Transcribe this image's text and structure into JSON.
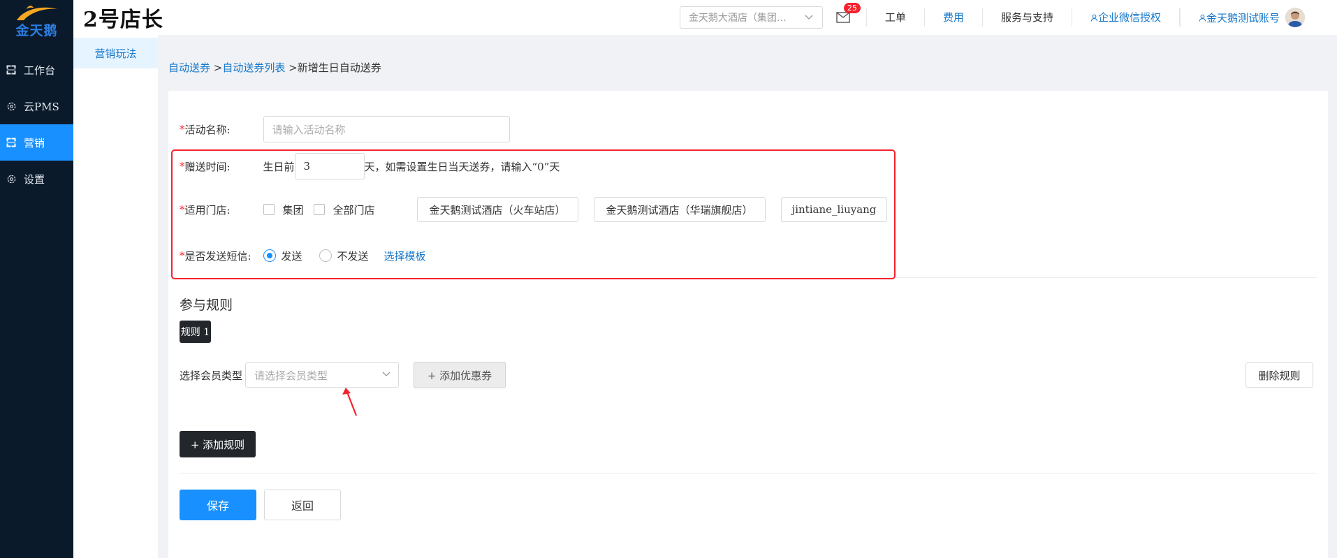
{
  "brand": {
    "logo_text": "金天鹅",
    "title": "2号店长"
  },
  "sidebar": {
    "items": [
      {
        "label": "工作台",
        "icon": "workspace-icon"
      },
      {
        "label": "云PMS",
        "icon": "gear-icon"
      },
      {
        "label": "营销",
        "icon": "marketing-icon",
        "active": true
      },
      {
        "label": "设置",
        "icon": "gear-icon"
      }
    ]
  },
  "submenu": {
    "items": [
      {
        "label": "营销玩法",
        "active": true
      }
    ]
  },
  "header": {
    "hotel_select": "金天鹅大酒店（集团…",
    "mail_badge": "25",
    "nav": [
      "工单",
      "费用",
      "服务与支持"
    ],
    "wechat_auth": "企业微信授权",
    "account": "金天鹅测试账号"
  },
  "breadcrumb": {
    "part1": "自动送券",
    "sep1": " >",
    "part2": "自动送券列表",
    "sep2": " >",
    "current": "新增生日自动送券"
  },
  "form": {
    "activity_name": {
      "required": "*",
      "label": "活动名称:",
      "placeholder": "请输入活动名称"
    },
    "gift_time": {
      "required": "*",
      "label": "赠送时间:",
      "prefix": "生日前",
      "value": "3",
      "suffix": "天，如需设置生日当天送券，请输入“0”天"
    },
    "stores": {
      "required": "*",
      "label": "适用门店:",
      "group_label": "集团",
      "all_label": "全部门店",
      "store_list": [
        "金天鹅测试酒店（火车站店）",
        "金天鹅测试酒店（华瑞旗舰店）",
        "jintiane_liuyang"
      ]
    },
    "sms": {
      "required": "*",
      "label": "是否发送短信:",
      "send": "发送",
      "no_send": "不发送",
      "template_link": "选择模板"
    }
  },
  "rules": {
    "title": "参与规则",
    "tab": "规则 1",
    "member_type_label": "选择会员类型",
    "member_type_placeholder": "请选择会员类型",
    "add_coupon": "+ 添加优惠券",
    "delete_rule": "删除规则",
    "add_rule": "+ 添加规则"
  },
  "actions": {
    "save": "保存",
    "back": "返回"
  },
  "colors": {
    "primary": "#1890ff",
    "sidebar_bg": "#0b1a2a",
    "highlight_border": "#f5222d",
    "dark_button": "#23272b"
  }
}
